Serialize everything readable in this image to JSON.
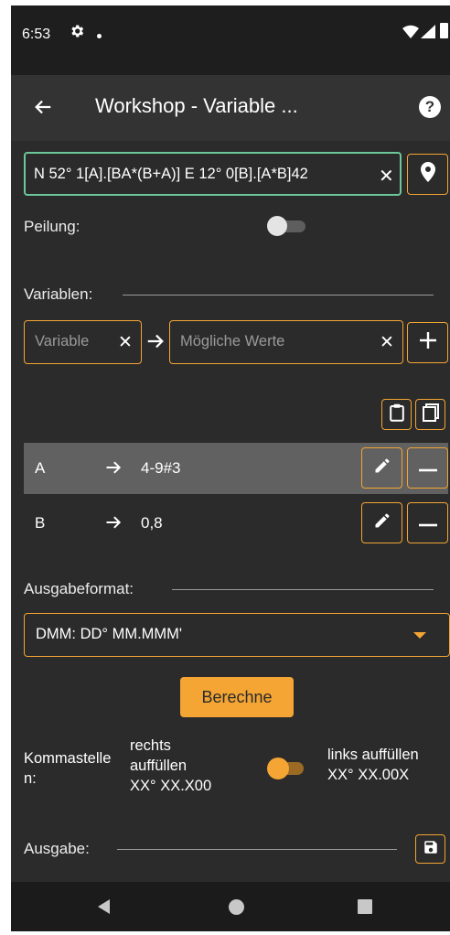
{
  "status": {
    "time": "6:53"
  },
  "appbar": {
    "title": "Workshop - Variable ..."
  },
  "coord_input": {
    "value": "N 52° 1[A].[BA*(B+A)] E 12° 0[B].[A*B]42"
  },
  "bearing": {
    "label": "Peilung:",
    "enabled": false
  },
  "variables": {
    "section_label": "Variablen:",
    "name_placeholder": "Variable",
    "values_placeholder": "Mögliche Werte",
    "rows": [
      {
        "name": "A",
        "values": "4-9#3"
      },
      {
        "name": "B",
        "values": "0,8"
      }
    ]
  },
  "output_format": {
    "section_label": "Ausgabeformat:",
    "selected": "DMM: DD° MM.MMM'"
  },
  "calculate": {
    "label": "Berechne"
  },
  "decimals": {
    "label": "Kommastellen:",
    "right_fill": "rechts auffüllen",
    "right_example": "XX° XX.X00",
    "left_fill": "links auffüllen",
    "left_example": "XX° XX.00X",
    "left_selected": true
  },
  "output": {
    "section_label": "Ausgabe:"
  },
  "colors": {
    "accent": "#f4a533",
    "input_border": "#6cc79b",
    "background": "#2b2b2b"
  }
}
